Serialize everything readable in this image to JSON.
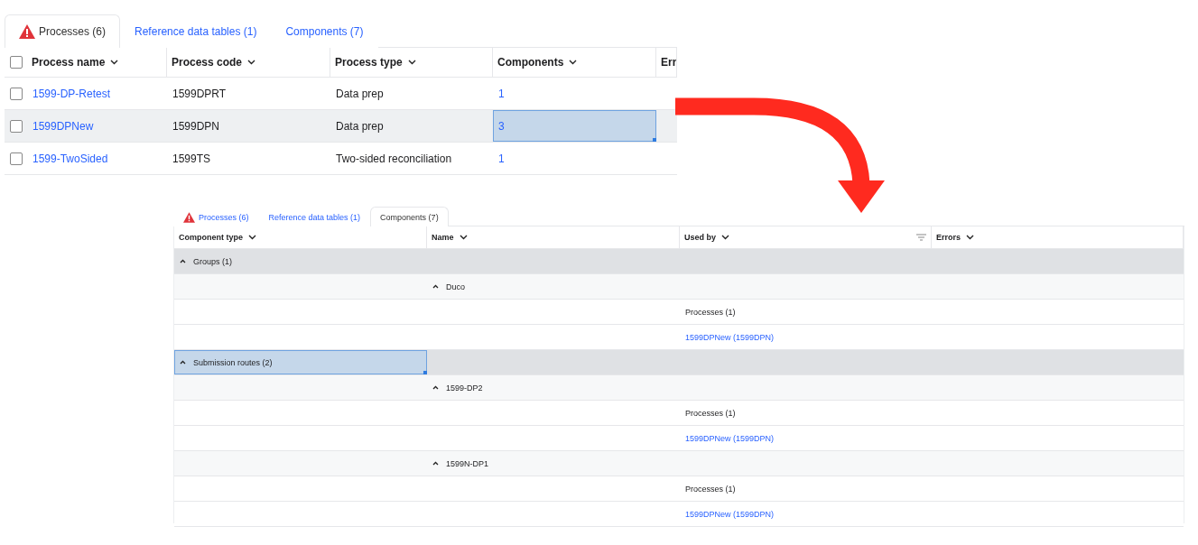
{
  "processes_view": {
    "tabs": [
      {
        "label": "Processes (6)",
        "selected": true,
        "warning": true
      },
      {
        "label": "Reference data tables (1)",
        "selected": false,
        "warning": false
      },
      {
        "label": "Components (7)",
        "selected": false,
        "warning": false
      }
    ],
    "select_all_checked": false,
    "columns": [
      "Process name",
      "Process code",
      "Process type",
      "Components",
      "Err"
    ],
    "rows": [
      {
        "checked": false,
        "hovered": false,
        "name": "1599-DP-Retest",
        "code": "1599DPRT",
        "type": "Data prep",
        "components": "1",
        "components_selected": false
      },
      {
        "checked": false,
        "hovered": true,
        "name": "1599DPNew",
        "code": "1599DPN",
        "type": "Data prep",
        "components": "3",
        "components_selected": true
      },
      {
        "checked": false,
        "hovered": false,
        "name": "1599-TwoSided",
        "code": "1599TS",
        "type": "Two-sided reconciliation",
        "components": "1",
        "components_selected": false
      }
    ]
  },
  "components_view": {
    "tabs": [
      {
        "label": "Processes (6)",
        "selected": false,
        "warning": true
      },
      {
        "label": "Reference data tables (1)",
        "selected": false,
        "warning": false
      },
      {
        "label": "Components (7)",
        "selected": true,
        "warning": false
      }
    ],
    "columns": [
      {
        "label": "Component type",
        "filter": false
      },
      {
        "label": "Name",
        "filter": false
      },
      {
        "label": "Used by",
        "filter": true
      },
      {
        "label": "Errors",
        "filter": false
      }
    ],
    "groups": [
      {
        "label": "Groups (1)",
        "expanded": true,
        "selected": false,
        "children": [
          {
            "label": "Duco",
            "expanded": true,
            "children": [
              {
                "label": "Processes (1)",
                "children": [
                  {
                    "label": "1599DPNew (1599DPN)"
                  }
                ]
              }
            ]
          }
        ]
      },
      {
        "label": "Submission routes (2)",
        "expanded": true,
        "selected": true,
        "children": [
          {
            "label": "1599-DP2",
            "expanded": true,
            "children": [
              {
                "label": "Processes (1)",
                "children": [
                  {
                    "label": "1599DPNew (1599DPN)"
                  }
                ]
              }
            ]
          },
          {
            "label": "1599N-DP1",
            "expanded": true,
            "children": [
              {
                "label": "Processes (1)",
                "children": [
                  {
                    "label": "1599DPNew (1599DPN)"
                  }
                ]
              }
            ]
          }
        ]
      }
    ]
  }
}
